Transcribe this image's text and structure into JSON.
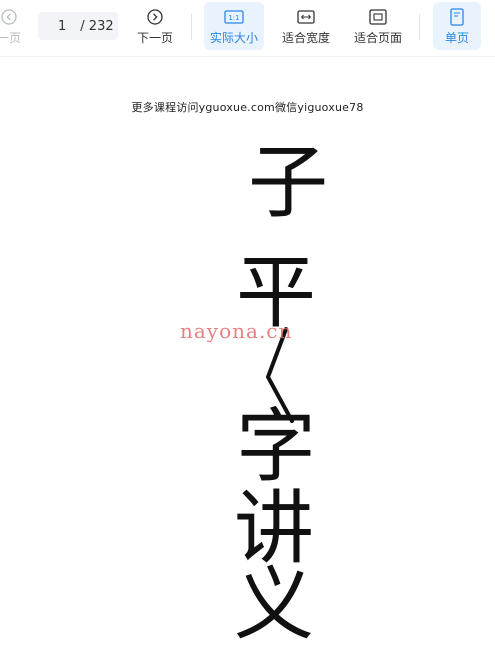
{
  "toolbar": {
    "prev_label": "一页",
    "page_current": "1",
    "page_total": "/ 232",
    "next_label": "下一页",
    "actual_size_label": "实际大小",
    "actual_size_icon_text": "1:1",
    "fit_width_label": "适合宽度",
    "fit_page_label": "适合页面",
    "single_page_label": "单页",
    "accent_color": "#2b86e6"
  },
  "document": {
    "promo_text": "更多课程访问yguoxue.com微信yiguoxue78",
    "title_chars": [
      "子",
      "平",
      "字",
      "讲",
      "义"
    ],
    "watermark": "nayona.cn"
  },
  "icons": {
    "prev": "chevron-left-circle-icon",
    "next": "chevron-right-circle-icon",
    "actual_size": "actual-size-icon",
    "fit_width": "fit-width-icon",
    "fit_page": "fit-page-icon",
    "single_page": "single-page-icon"
  }
}
